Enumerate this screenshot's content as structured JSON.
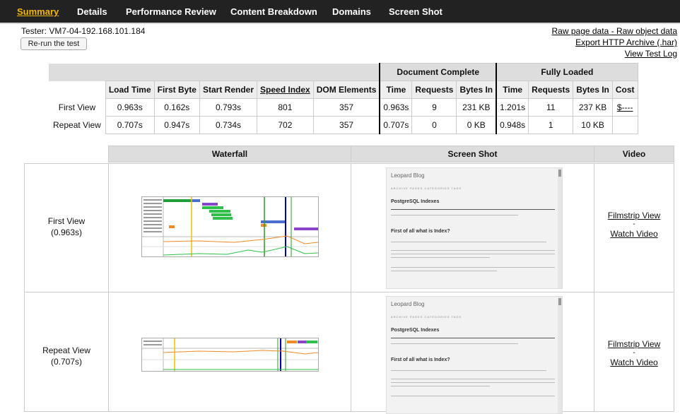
{
  "nav": {
    "tabs": [
      "Summary",
      "Details",
      "Performance Review",
      "Content Breakdown",
      "Domains",
      "Screen Shot"
    ],
    "active": "Summary"
  },
  "tester": "Tester: VM7-04-192.168.101.184",
  "rerun_label": "Re-run the test",
  "links": {
    "raw_page": "Raw page data",
    "separator": "-",
    "raw_object": "Raw object data",
    "export_har": "Export HTTP Archive (.har)",
    "view_log": "View Test Log"
  },
  "results": {
    "group_headers": {
      "document_complete": "Document Complete",
      "fully_loaded": "Fully Loaded"
    },
    "columns": [
      "Load Time",
      "First Byte",
      "Start Render",
      "Speed Index",
      "DOM Elements",
      "Time",
      "Requests",
      "Bytes In",
      "Time",
      "Requests",
      "Bytes In",
      "Cost"
    ],
    "rows": [
      {
        "label": "First View",
        "values": [
          "0.963s",
          "0.162s",
          "0.793s",
          "801",
          "357",
          "0.963s",
          "9",
          "231 KB",
          "1.201s",
          "11",
          "237 KB",
          "$----"
        ]
      },
      {
        "label": "Repeat View",
        "values": [
          "0.707s",
          "0.947s",
          "0.734s",
          "702",
          "357",
          "0.707s",
          "0",
          "0 KB",
          "0.948s",
          "1",
          "10 KB",
          ""
        ]
      }
    ]
  },
  "views_table": {
    "headers": [
      "Waterfall",
      "Screen Shot",
      "Video"
    ],
    "rows": [
      {
        "label": "First View",
        "time": "(0.963s)",
        "filmstrip": "Filmstrip View",
        "dash": "-",
        "video": "Watch Video"
      },
      {
        "label": "Repeat View",
        "time": "(0.707s)",
        "filmstrip": "Filmstrip View",
        "dash": "-",
        "video": "Watch Video"
      }
    ]
  },
  "screenshot": {
    "blog_title": "Leopard Blog",
    "menu": "ARCHIVE   PAGES   CATEGORIES   TAGS",
    "post_title": "PostgreSQL Indexes",
    "subheading": "First of all what is Index?"
  }
}
